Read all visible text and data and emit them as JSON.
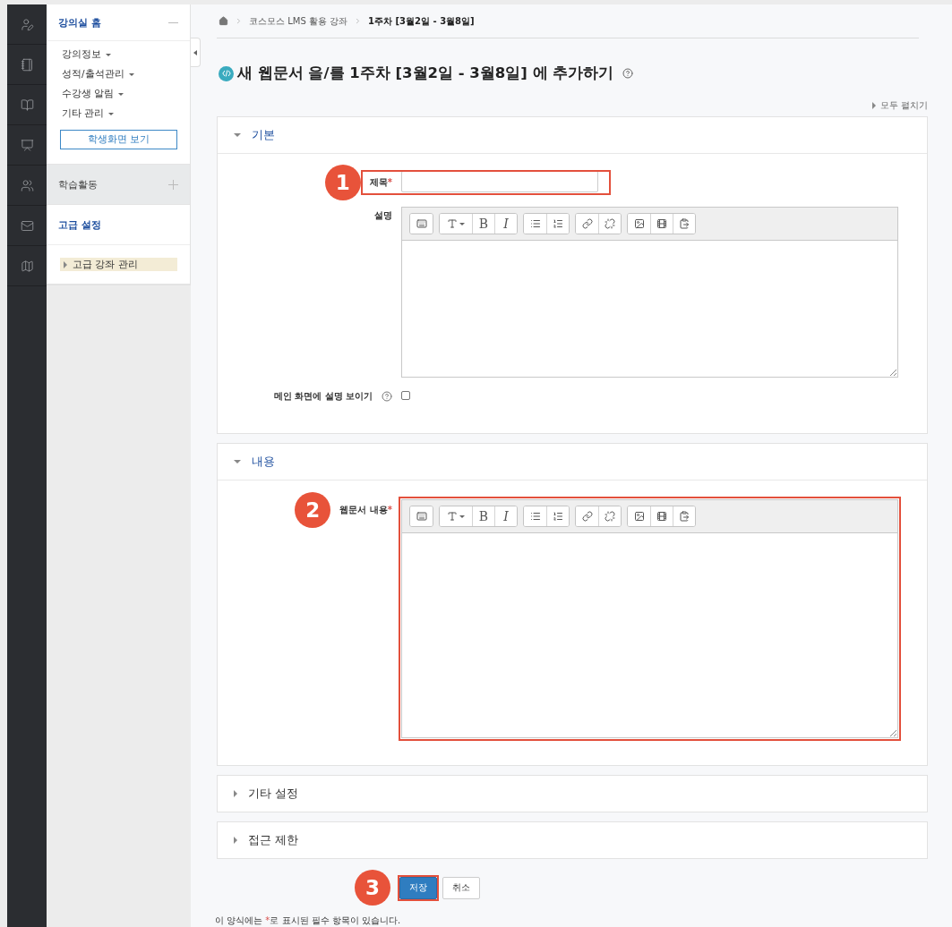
{
  "sidebar": {
    "sections": [
      {
        "title": "강의실 홈",
        "expanded": true,
        "highlight": false,
        "items": [
          {
            "label": "강의정보"
          },
          {
            "label": "성적/출석관리"
          },
          {
            "label": "수강생 알림"
          },
          {
            "label": "기타 관리"
          }
        ],
        "button": "학생화면 보기"
      },
      {
        "title": "학습활동",
        "expanded": false,
        "highlight": true
      },
      {
        "title": "고급 설정",
        "expanded": true,
        "highlight": false,
        "tree": [
          {
            "label": "고급 강좌 관리",
            "selected": true
          }
        ]
      }
    ]
  },
  "breadcrumb": [
    "코스모스 LMS 활용 강좌",
    "1주차 [3월2일 - 3월8일]"
  ],
  "heading": "새 웹문서 을/를 1주차 [3월2일 - 3월8일] 에 추가하기",
  "expand_all": "모두 펼치기",
  "sections": [
    {
      "title": "기본",
      "expanded": true,
      "fields": [
        {
          "kind": "text",
          "label": "제목",
          "required_mark": "*",
          "step": "1"
        },
        {
          "kind": "editor",
          "label": "설명",
          "tall": false,
          "toolbar": [
            [
              {
                "kind": "table"
              }
            ],
            [
              {
                "kind": "font"
              },
              {
                "kind": "bold",
                "text": "B"
              },
              {
                "kind": "italic",
                "text": "I"
              }
            ],
            [
              {
                "kind": "bullets"
              },
              {
                "kind": "numbers"
              }
            ],
            [
              {
                "kind": "link"
              },
              {
                "kind": "unlink"
              }
            ],
            [
              {
                "kind": "image"
              },
              {
                "kind": "media"
              },
              {
                "kind": "paste"
              }
            ]
          ]
        },
        {
          "kind": "checkbox",
          "label": "메인 화면에 설명 보이기",
          "checked": false
        }
      ]
    },
    {
      "title": "내용",
      "expanded": true,
      "fields": [
        {
          "kind": "editor",
          "label": "웹문서 내용",
          "required_mark": "*",
          "step": "2",
          "tall": true,
          "toolbar": [
            [
              {
                "kind": "table"
              }
            ],
            [
              {
                "kind": "font"
              },
              {
                "kind": "bold",
                "text": "B"
              },
              {
                "kind": "italic",
                "text": "I"
              }
            ],
            [
              {
                "kind": "bullets"
              },
              {
                "kind": "numbers"
              }
            ],
            [
              {
                "kind": "link"
              },
              {
                "kind": "unlink"
              }
            ],
            [
              {
                "kind": "image"
              },
              {
                "kind": "media"
              },
              {
                "kind": "paste"
              }
            ]
          ]
        }
      ]
    },
    {
      "title": "기타 설정",
      "expanded": false
    },
    {
      "title": "접근 제한",
      "expanded": false
    }
  ],
  "buttons": [
    {
      "label": "저장",
      "kind": "primary",
      "step": "3"
    },
    {
      "label": "취소",
      "kind": "default"
    }
  ],
  "footnote": {
    "before": "이 양식에는 ",
    "mark": "*",
    "after": "로 표시된 필수 항목이 있습니다."
  }
}
